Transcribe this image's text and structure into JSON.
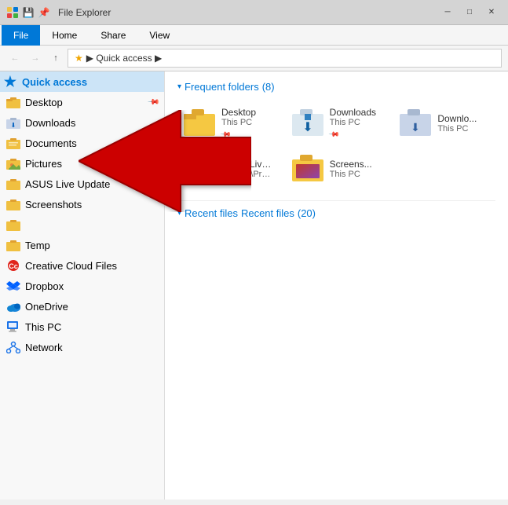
{
  "titleBar": {
    "title": "File Explorer",
    "controls": [
      "─",
      "□",
      "✕"
    ]
  },
  "ribbon": {
    "tabs": [
      "File",
      "Home",
      "Share",
      "View"
    ]
  },
  "addressBar": {
    "path": "Quick access",
    "breadcrumb": "▶ Quick access ▶"
  },
  "sidebar": {
    "quickAccessLabel": "Quick access",
    "items": [
      {
        "id": "desktop",
        "label": "Desktop",
        "icon": "folder",
        "pinned": true
      },
      {
        "id": "downloads",
        "label": "Downloads",
        "icon": "folder-down",
        "pinned": false
      },
      {
        "id": "documents",
        "label": "Documents",
        "icon": "docs",
        "pinned": false
      },
      {
        "id": "pictures",
        "label": "Pictures",
        "icon": "pics",
        "pinned": true
      },
      {
        "id": "asus-live-update",
        "label": "ASUS Live Update",
        "icon": "folder",
        "pinned": false
      },
      {
        "id": "screenshots",
        "label": "Screenshots",
        "icon": "folder",
        "pinned": false
      },
      {
        "id": "unnamed",
        "label": "",
        "icon": "folder",
        "pinned": false
      },
      {
        "id": "temp",
        "label": "Temp",
        "icon": "folder",
        "pinned": false
      },
      {
        "id": "creative-cloud",
        "label": "Creative Cloud Files",
        "icon": "creative",
        "pinned": false
      },
      {
        "id": "dropbox",
        "label": "Dropbox",
        "icon": "dropbox",
        "pinned": false
      },
      {
        "id": "onedrive",
        "label": "OneDrive",
        "icon": "onedrive",
        "pinned": false
      },
      {
        "id": "this-pc",
        "label": "This PC",
        "icon": "thispc",
        "pinned": false
      },
      {
        "id": "network",
        "label": "Network",
        "icon": "network",
        "pinned": false
      }
    ]
  },
  "content": {
    "frequentFolders": {
      "title": "Frequent folders",
      "count": 8,
      "folders": [
        {
          "id": "desktop-folder",
          "name": "Desktop",
          "subtitle": "This PC",
          "type": "normal",
          "pinned": true
        },
        {
          "id": "downloads-folder",
          "name": "Downloads",
          "subtitle": "This PC",
          "type": "downloads",
          "pinned": true
        },
        {
          "id": "asus-update-folder",
          "name": "ASUS Live Update",
          "subtitle": "OS (C:)\\ProgramData\\ASUS",
          "type": "asus",
          "pinned": false
        },
        {
          "id": "screenshots-folder",
          "name": "Screenshots",
          "subtitle": "This PC",
          "type": "screenshot",
          "pinned": false
        }
      ]
    },
    "recentFiles": {
      "title": "Recent files",
      "count": 20
    }
  }
}
